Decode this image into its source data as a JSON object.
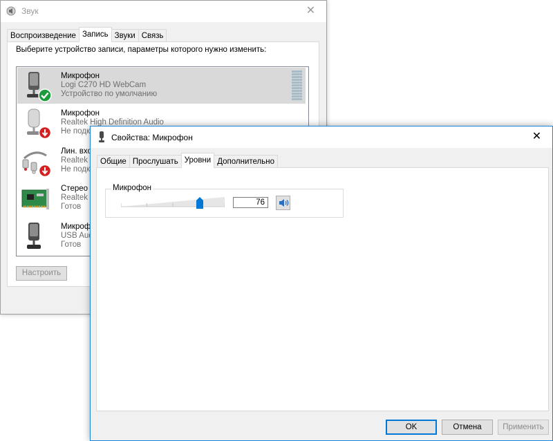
{
  "sound_window": {
    "title": "Звук",
    "close_glyph": "✕",
    "tabs": [
      {
        "label": "Воспроизведение",
        "active": false
      },
      {
        "label": "Запись",
        "active": true
      },
      {
        "label": "Звуки",
        "active": false
      },
      {
        "label": "Связь",
        "active": false
      }
    ],
    "instruction": "Выберите устройство записи, параметры которого нужно изменить:",
    "devices": [
      {
        "name": "Микрофон",
        "driver": "Logi C270 HD WebCam",
        "status": "Устройство по умолчанию",
        "icon": "microphone-webcam-icon",
        "badge": "default-check-icon",
        "selected": true
      },
      {
        "name": "Микрофон",
        "driver": "Realtek High Definition Audio",
        "status": "Не подк",
        "icon": "microphone-icon",
        "badge": "disconnected-arrow-icon",
        "selected": false
      },
      {
        "name": "Лин. вхо",
        "driver": "Realtek",
        "status": "Не подк",
        "icon": "line-in-cable-icon",
        "badge": "disconnected-arrow-icon",
        "selected": false
      },
      {
        "name": "Стерео м",
        "driver": "Realtek",
        "status": "Готов",
        "icon": "sound-card-icon",
        "badge": "",
        "selected": false
      },
      {
        "name": "Микроф",
        "driver": "USB Aud",
        "status": "Готов",
        "icon": "microphone-usb-icon",
        "badge": "",
        "selected": false
      }
    ],
    "configure_label": "Настроить"
  },
  "props_window": {
    "title": "Свойства: Микрофон",
    "close_glyph": "✕",
    "tabs": [
      {
        "label": "Общие",
        "active": false
      },
      {
        "label": "Прослушать",
        "active": false
      },
      {
        "label": "Уровни",
        "active": true
      },
      {
        "label": "Дополнительно",
        "active": false
      }
    ],
    "levels": {
      "group_label": "Микрофон",
      "level_value": "76",
      "level_fraction": 0.76,
      "mute_icon": "speaker-icon"
    },
    "buttons": {
      "ok": "OK",
      "cancel": "Отмена",
      "apply": "Применить"
    }
  },
  "colors": {
    "accent": "#0078d7",
    "selection": "#d9d9d9",
    "status_gray": "#6d6d6d",
    "check_green": "#1e9b3c",
    "arrow_red": "#d42020"
  }
}
